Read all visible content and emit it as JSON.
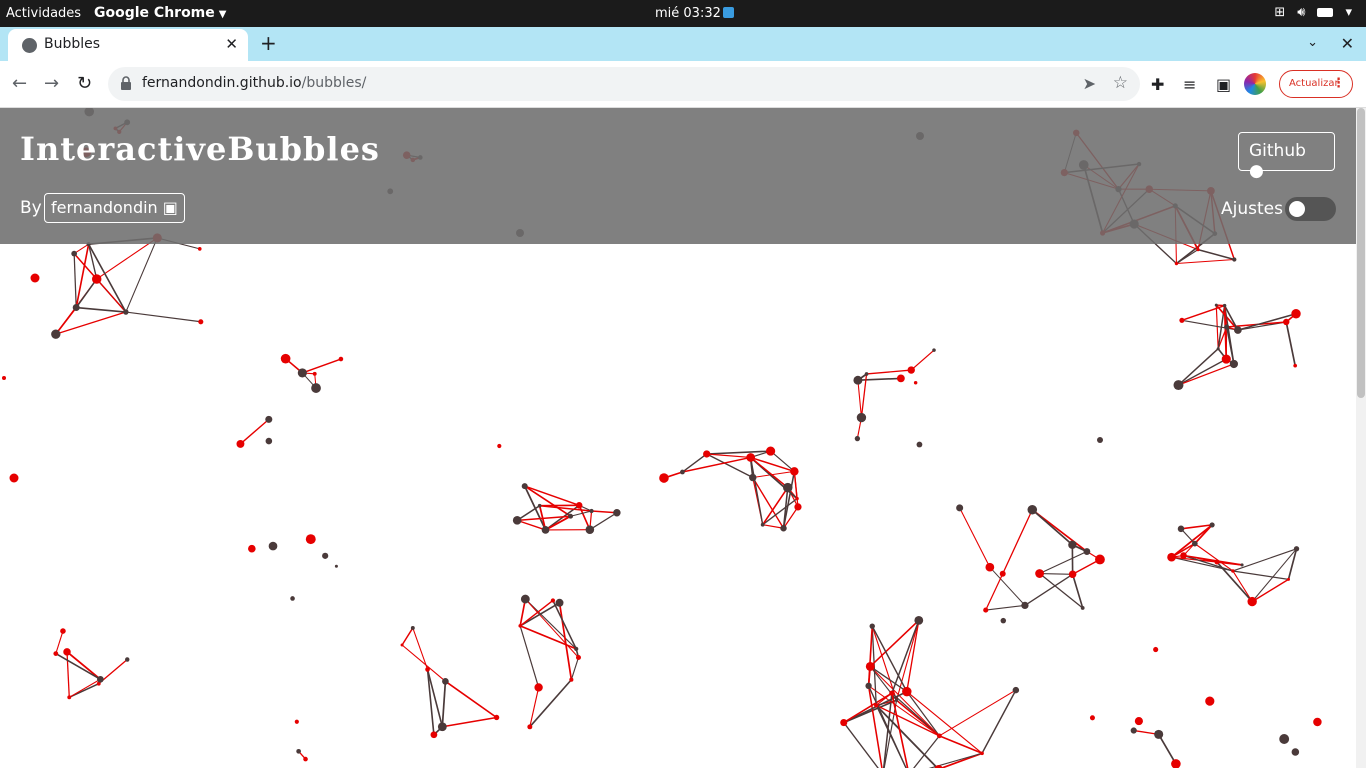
{
  "system_bar": {
    "activities": "Actividades",
    "app_name": "Google Chrome",
    "clock": "mié 03:32",
    "tray_icons": [
      "network-icon",
      "volume-icon",
      "battery-icon",
      "chevron-down-icon"
    ]
  },
  "browser": {
    "tab_title": "Bubbles",
    "url_host": "fernandondin.github.io",
    "url_path": "/bubbles/",
    "update_label": "Actualizar"
  },
  "header": {
    "title": "InteractiveBubbles",
    "by_label": "By",
    "author": "fernandondin",
    "github_label": "Github",
    "settings_label": "Ajustes",
    "settings_enabled": false
  },
  "colors": {
    "header_bg": "#6e6e6e",
    "node_red": "#e60000",
    "node_dark": "#4a3a3a",
    "tabstrip": "#b3e5f5"
  }
}
